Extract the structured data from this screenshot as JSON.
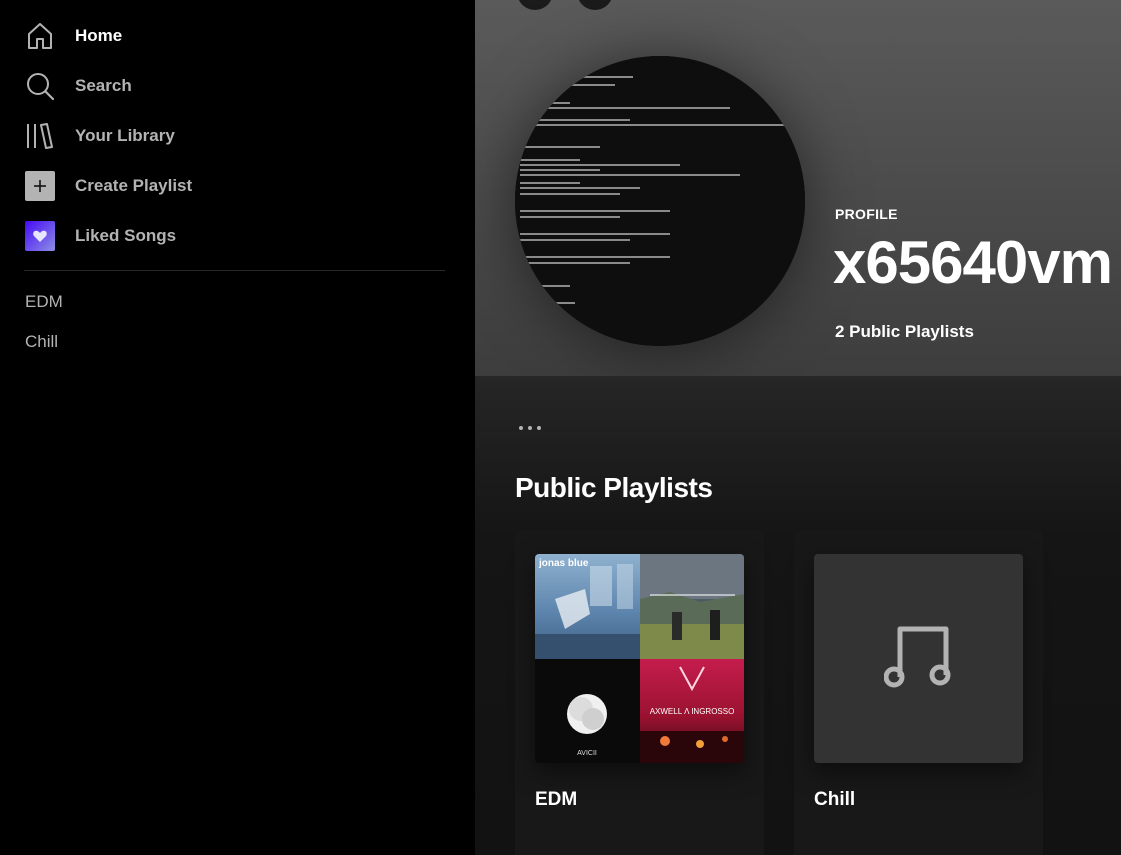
{
  "sidebar": {
    "nav": {
      "home": "Home",
      "search": "Search",
      "library": "Your Library",
      "create_playlist": "Create Playlist",
      "liked_songs": "Liked Songs"
    },
    "playlists": [
      "EDM",
      "Chill"
    ]
  },
  "profile": {
    "type_label": "PROFILE",
    "username": "x65640vm",
    "meta": "2 Public Playlists"
  },
  "section": {
    "title": "Public Playlists"
  },
  "cards": [
    {
      "title": "EDM"
    },
    {
      "title": "Chill"
    }
  ],
  "artwork": {
    "album1_text": "jonas blue",
    "album3_text": "AVICII",
    "album4_text": "AXWELL Λ INGROSSO"
  },
  "colors": {
    "sidebar_bg": "#000000",
    "main_bg": "#121212",
    "header_bg": "#535353",
    "text_primary": "#ffffff",
    "text_secondary": "#b3b3b3",
    "card_bg": "#181818"
  }
}
